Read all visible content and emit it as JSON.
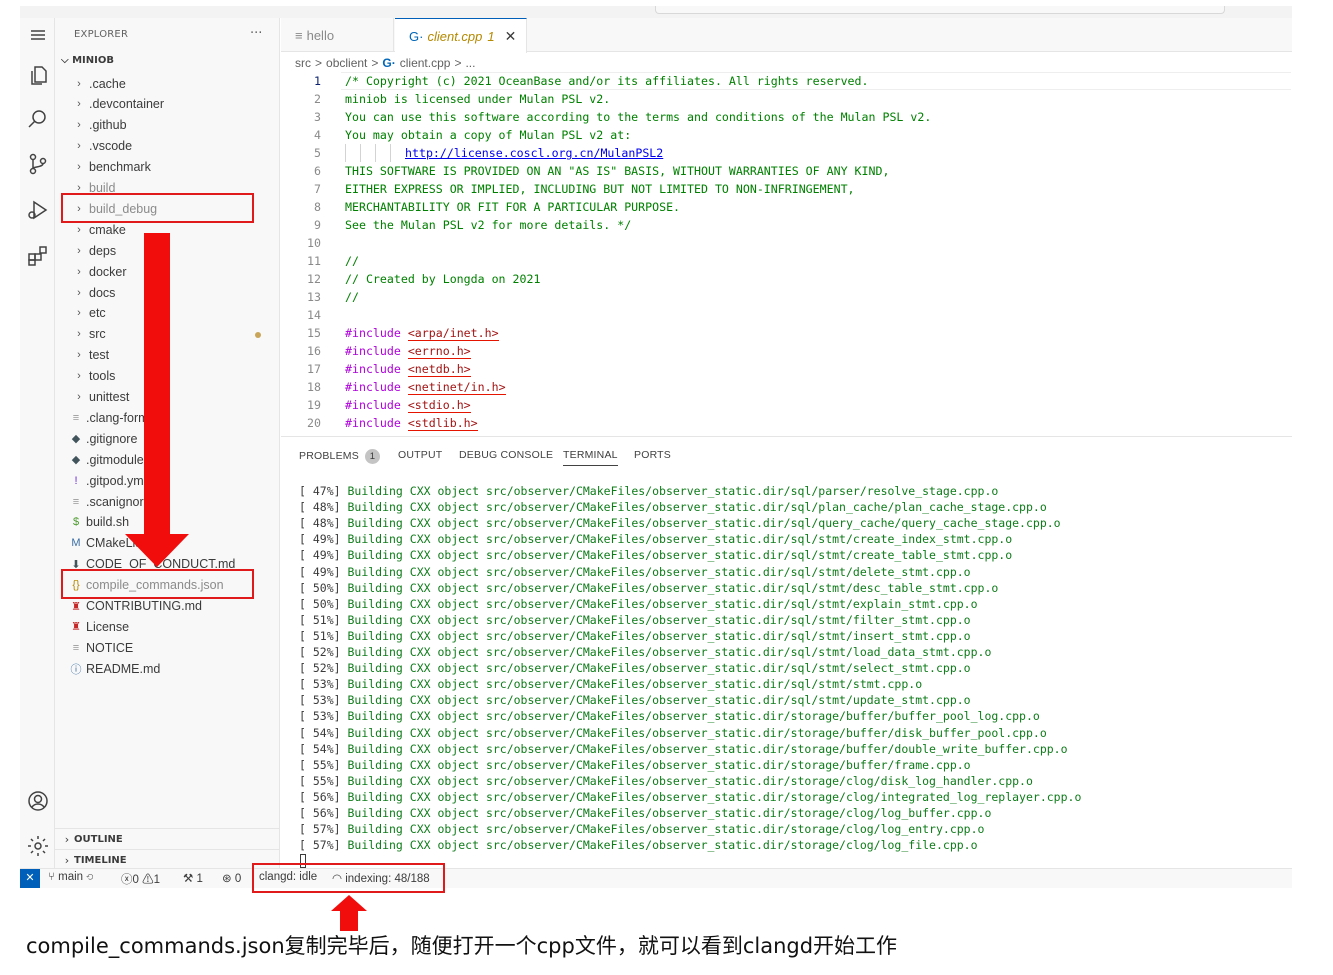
{
  "explorer": {
    "title": "EXPLORER",
    "more": "···",
    "root": "MINIOB",
    "items": [
      {
        "label": ".cache",
        "kind": "folder"
      },
      {
        "label": ".devcontainer",
        "kind": "folder"
      },
      {
        "label": ".github",
        "kind": "folder"
      },
      {
        "label": ".vscode",
        "kind": "folder"
      },
      {
        "label": "benchmark",
        "kind": "folder"
      },
      {
        "label": "build",
        "kind": "folder",
        "dim": true
      },
      {
        "label": "build_debug",
        "kind": "folder",
        "dim": true
      },
      {
        "label": "cmake",
        "kind": "folder"
      },
      {
        "label": "deps",
        "kind": "folder"
      },
      {
        "label": "docker",
        "kind": "folder"
      },
      {
        "label": "docs",
        "kind": "folder"
      },
      {
        "label": "etc",
        "kind": "folder"
      },
      {
        "label": "src",
        "kind": "folder",
        "modified": true
      },
      {
        "label": "test",
        "kind": "folder"
      },
      {
        "label": "tools",
        "kind": "folder"
      },
      {
        "label": "unittest",
        "kind": "folder"
      },
      {
        "label": ".clang-format",
        "kind": "file",
        "icon": "≡"
      },
      {
        "label": ".gitignore",
        "kind": "file",
        "icon": "◆"
      },
      {
        "label": ".gitmodules",
        "kind": "file",
        "icon": "◆"
      },
      {
        "label": ".gitpod.yml",
        "kind": "file",
        "icon": "!"
      },
      {
        "label": ".scanignore",
        "kind": "file",
        "icon": "≡"
      },
      {
        "label": "build.sh",
        "kind": "file",
        "icon": "$"
      },
      {
        "label": "CMakeLists.txt",
        "kind": "file",
        "icon": "M"
      },
      {
        "label": "CODE_OF_CONDUCT.md",
        "kind": "file",
        "icon": "⬇"
      },
      {
        "label": "compile_commands.json",
        "kind": "file",
        "icon": "{}",
        "dim": true
      },
      {
        "label": "CONTRIBUTING.md",
        "kind": "file",
        "icon": "♜"
      },
      {
        "label": "License",
        "kind": "file",
        "icon": "♜"
      },
      {
        "label": "NOTICE",
        "kind": "file",
        "icon": "≡"
      },
      {
        "label": "README.md",
        "kind": "file",
        "icon": "ⓘ"
      }
    ],
    "outline": "OUTLINE",
    "timeline": "TIMELINE"
  },
  "tabs": [
    {
      "label": "hello",
      "icon": "≡",
      "active": false
    },
    {
      "label": "client.cpp",
      "icon": "G·",
      "badge": "1",
      "active": true,
      "close": "✕"
    }
  ],
  "breadcrumb": [
    "src",
    ">",
    "obclient",
    ">",
    "G·",
    "client.cpp",
    ">",
    "..."
  ],
  "editor": {
    "lines": [
      {
        "n": "1",
        "t": "/* Copyright (c) 2021 OceanBase and/or its affiliates. All rights reserved.",
        "c": "cmt"
      },
      {
        "n": "2",
        "t": "miniob is licensed under Mulan PSL v2.",
        "c": "cmt"
      },
      {
        "n": "3",
        "t": "You can use this software according to the terms and conditions of the Mulan PSL v2.",
        "c": "cmt"
      },
      {
        "n": "4",
        "t": "You may obtain a copy of Mulan PSL v2 at:",
        "c": "cmt"
      },
      {
        "n": "5",
        "t": "http://license.coscl.org.cn/MulanPSL2",
        "c": "link"
      },
      {
        "n": "6",
        "t": "THIS SOFTWARE IS PROVIDED ON AN \"AS IS\" BASIS, WITHOUT WARRANTIES OF ANY KIND,",
        "c": "cmt"
      },
      {
        "n": "7",
        "t": "EITHER EXPRESS OR IMPLIED, INCLUDING BUT NOT LIMITED TO NON-INFRINGEMENT,",
        "c": "cmt"
      },
      {
        "n": "8",
        "t": "MERCHANTABILITY OR FIT FOR A PARTICULAR PURPOSE.",
        "c": "cmt"
      },
      {
        "n": "9",
        "t": "See the Mulan PSL v2 for more details. */",
        "c": "cmt"
      },
      {
        "n": "10",
        "t": "",
        "c": "cmt"
      },
      {
        "n": "11",
        "t": "//",
        "c": "cmt"
      },
      {
        "n": "12",
        "t": "// Created by Longda on 2021",
        "c": "cmt"
      },
      {
        "n": "13",
        "t": "//",
        "c": "cmt"
      },
      {
        "n": "14",
        "t": "",
        "c": "cmt"
      },
      {
        "n": "15",
        "t": "#include",
        "h": "<arpa/inet.h>",
        "c": "inc"
      },
      {
        "n": "16",
        "t": "#include",
        "h": "<errno.h>",
        "c": "inc"
      },
      {
        "n": "17",
        "t": "#include",
        "h": "<netdb.h>",
        "c": "inc"
      },
      {
        "n": "18",
        "t": "#include",
        "h": "<netinet/in.h>",
        "c": "inc"
      },
      {
        "n": "19",
        "t": "#include",
        "h": "<stdio.h>",
        "c": "inc"
      },
      {
        "n": "20",
        "t": "#include",
        "h": "<stdlib.h>",
        "c": "inc"
      }
    ]
  },
  "panel": {
    "tabs": [
      {
        "label": "PROBLEMS",
        "badge": "1"
      },
      {
        "label": "OUTPUT"
      },
      {
        "label": "DEBUG CONSOLE"
      },
      {
        "label": "TERMINAL",
        "active": true
      },
      {
        "label": "PORTS"
      }
    ],
    "terminal": [
      {
        "p": "[ 47%]",
        "t": "src/observer/CMakeFiles/observer_static.dir/sql/parser/resolve_stage.cpp.o"
      },
      {
        "p": "[ 48%]",
        "t": "src/observer/CMakeFiles/observer_static.dir/sql/plan_cache/plan_cache_stage.cpp.o"
      },
      {
        "p": "[ 48%]",
        "t": "src/observer/CMakeFiles/observer_static.dir/sql/query_cache/query_cache_stage.cpp.o"
      },
      {
        "p": "[ 49%]",
        "t": "src/observer/CMakeFiles/observer_static.dir/sql/stmt/create_index_stmt.cpp.o"
      },
      {
        "p": "[ 49%]",
        "t": "src/observer/CMakeFiles/observer_static.dir/sql/stmt/create_table_stmt.cpp.o"
      },
      {
        "p": "[ 49%]",
        "t": "src/observer/CMakeFiles/observer_static.dir/sql/stmt/delete_stmt.cpp.o"
      },
      {
        "p": "[ 50%]",
        "t": "src/observer/CMakeFiles/observer_static.dir/sql/stmt/desc_table_stmt.cpp.o"
      },
      {
        "p": "[ 50%]",
        "t": "src/observer/CMakeFiles/observer_static.dir/sql/stmt/explain_stmt.cpp.o"
      },
      {
        "p": "[ 51%]",
        "t": "src/observer/CMakeFiles/observer_static.dir/sql/stmt/filter_stmt.cpp.o"
      },
      {
        "p": "[ 51%]",
        "t": "src/observer/CMakeFiles/observer_static.dir/sql/stmt/insert_stmt.cpp.o"
      },
      {
        "p": "[ 52%]",
        "t": "src/observer/CMakeFiles/observer_static.dir/sql/stmt/load_data_stmt.cpp.o"
      },
      {
        "p": "[ 52%]",
        "t": "src/observer/CMakeFiles/observer_static.dir/sql/stmt/select_stmt.cpp.o"
      },
      {
        "p": "[ 53%]",
        "t": "src/observer/CMakeFiles/observer_static.dir/sql/stmt/stmt.cpp.o"
      },
      {
        "p": "[ 53%]",
        "t": "src/observer/CMakeFiles/observer_static.dir/sql/stmt/update_stmt.cpp.o"
      },
      {
        "p": "[ 53%]",
        "t": "src/observer/CMakeFiles/observer_static.dir/storage/buffer/buffer_pool_log.cpp.o"
      },
      {
        "p": "[ 54%]",
        "t": "src/observer/CMakeFiles/observer_static.dir/storage/buffer/disk_buffer_pool.cpp.o"
      },
      {
        "p": "[ 54%]",
        "t": "src/observer/CMakeFiles/observer_static.dir/storage/buffer/double_write_buffer.cpp.o"
      },
      {
        "p": "[ 55%]",
        "t": "src/observer/CMakeFiles/observer_static.dir/storage/buffer/frame.cpp.o"
      },
      {
        "p": "[ 55%]",
        "t": "src/observer/CMakeFiles/observer_static.dir/storage/clog/disk_log_handler.cpp.o"
      },
      {
        "p": "[ 56%]",
        "t": "src/observer/CMakeFiles/observer_static.dir/storage/clog/integrated_log_replayer.cpp.o"
      },
      {
        "p": "[ 56%]",
        "t": "src/observer/CMakeFiles/observer_static.dir/storage/clog/log_buffer.cpp.o"
      },
      {
        "p": "[ 57%]",
        "t": "src/observer/CMakeFiles/observer_static.dir/storage/clog/log_entry.cpp.o"
      },
      {
        "p": "[ 57%]",
        "t": "src/observer/CMakeFiles/observer_static.dir/storage/clog/log_file.cpp.o"
      }
    ],
    "building": "Building CXX object"
  },
  "statusbar": {
    "remote": "✕",
    "branch": "main",
    "errors": "0",
    "warnings": "1",
    "tools": "1",
    "ports": "0",
    "clangd": "clangd: idle",
    "indexing": "indexing: 48/188"
  },
  "caption": "compile_commands.json复制完毕后，随便打开一个cpp文件，就可以看到clangd开始工作",
  "colors": {
    "highlight": "#e0191b",
    "arrow": "#f20d0d",
    "accent": "#005fb8"
  }
}
